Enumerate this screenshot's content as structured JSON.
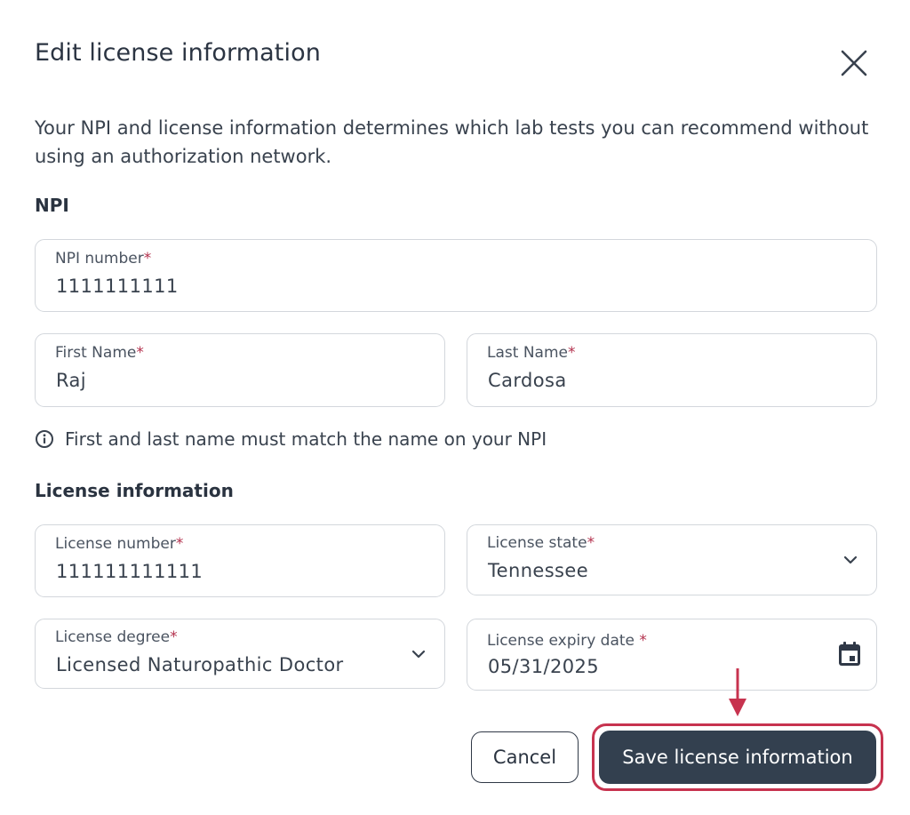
{
  "dialog": {
    "title": "Edit license information",
    "intro": "Your NPI and license information determines which lab tests you can recommend without using an authorization network."
  },
  "npi_section": {
    "heading": "NPI",
    "npi_number": {
      "label": "NPI number",
      "required": "*",
      "value": "1111111111"
    },
    "first_name": {
      "label": "First Name",
      "required": "*",
      "value": "Raj"
    },
    "last_name": {
      "label": "Last Name",
      "required": "*",
      "value": "Cardosa"
    },
    "hint": "First and last name must match the name on your NPI"
  },
  "license_section": {
    "heading": "License information",
    "license_number": {
      "label": "License number",
      "required": "*",
      "value": "111111111111"
    },
    "license_state": {
      "label": "License state",
      "required": "*",
      "value": "Tennessee"
    },
    "license_degree": {
      "label": "License degree",
      "required": "*",
      "value": "Licensed Naturopathic Doctor"
    },
    "license_expiry": {
      "label": "License expiry date ",
      "required": "*",
      "value": "05/31/2025"
    }
  },
  "actions": {
    "cancel_label": "Cancel",
    "save_label": "Save license information"
  },
  "icons": {
    "close": "close-icon",
    "info": "info-icon",
    "chevron": "chevron-down-icon",
    "calendar": "calendar-icon",
    "arrow": "arrow-down-icon"
  },
  "colors": {
    "primary_button": "#33404f",
    "required_asterisk": "#b4324e",
    "highlight": "#c7334f"
  }
}
